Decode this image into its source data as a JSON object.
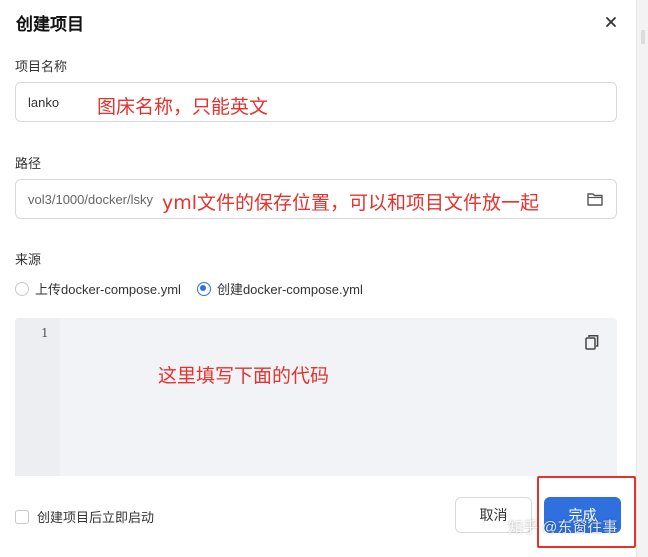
{
  "dialog": {
    "title": "创建项目"
  },
  "project_name": {
    "label": "项目名称",
    "value": "lanko",
    "annotation": "图床名称，只能英文"
  },
  "path": {
    "label": "路径",
    "value": "vol3/1000/docker/lsky",
    "annotation": "yml文件的保存位置，可以和项目文件放一起"
  },
  "source": {
    "label": "来源",
    "options": [
      "上传docker-compose.yml",
      "创建docker-compose.yml"
    ],
    "selected_index": 1
  },
  "editor": {
    "line_number": "1",
    "annotation": "这里填写下面的代码"
  },
  "footer": {
    "start_after_create": "创建项目后立即启动",
    "start_after_create_checked": false,
    "cancel_label": "取消",
    "done_label": "完成"
  },
  "watermark": "知乎 @东窗往事",
  "colors": {
    "accent": "#2f6fde",
    "annotation": "#e5322d"
  },
  "icons": [
    "close-icon",
    "folder-icon",
    "copy-icon"
  ]
}
